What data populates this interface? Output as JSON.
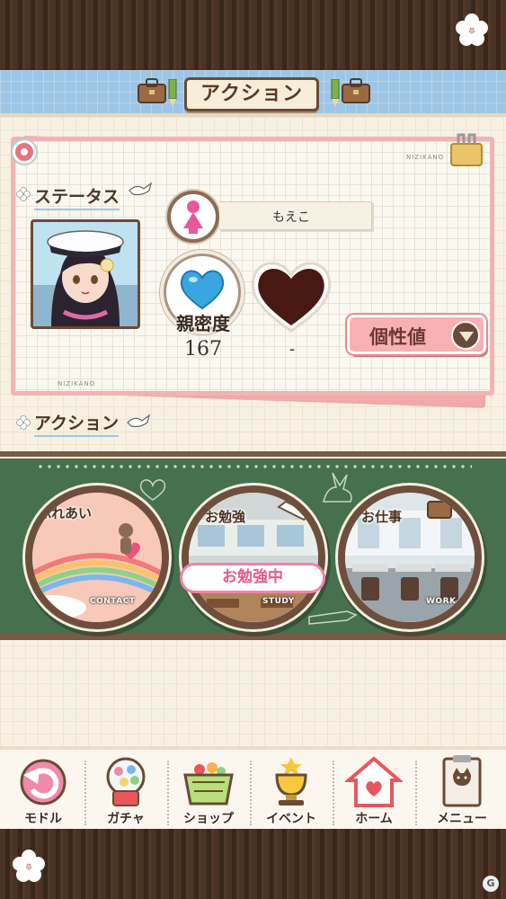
{
  "header": {
    "title": "アクション"
  },
  "status": {
    "section_title": "ステータス",
    "character_name": "もえこ",
    "intimacy_label": "親密度",
    "intimacy_value": "167",
    "second_value": "-",
    "personality_button": "個性値",
    "card_tag": "NIZIKANO"
  },
  "action": {
    "section_title": "アクション",
    "items": [
      {
        "label": "ふれあい",
        "sub": "CONTACT"
      },
      {
        "label": "お勉強",
        "sub": "STUDY"
      },
      {
        "label": "お仕事",
        "sub": "WORK"
      }
    ],
    "studying_badge": "お勉強中"
  },
  "nav": {
    "items": [
      {
        "label": "モドル",
        "icon": "back-arrow-icon"
      },
      {
        "label": "ガチャ",
        "icon": "gacha-machine-icon"
      },
      {
        "label": "ショップ",
        "icon": "shopping-basket-icon"
      },
      {
        "label": "イベント",
        "icon": "trophy-icon"
      },
      {
        "label": "ホーム",
        "icon": "house-icon"
      },
      {
        "label": "メニュー",
        "icon": "menu-book-icon"
      }
    ]
  },
  "colors": {
    "header_blue": "#9dc6e6",
    "board_green": "#46704e",
    "pink": "#f7b1b4",
    "wood": "#4a3224"
  }
}
